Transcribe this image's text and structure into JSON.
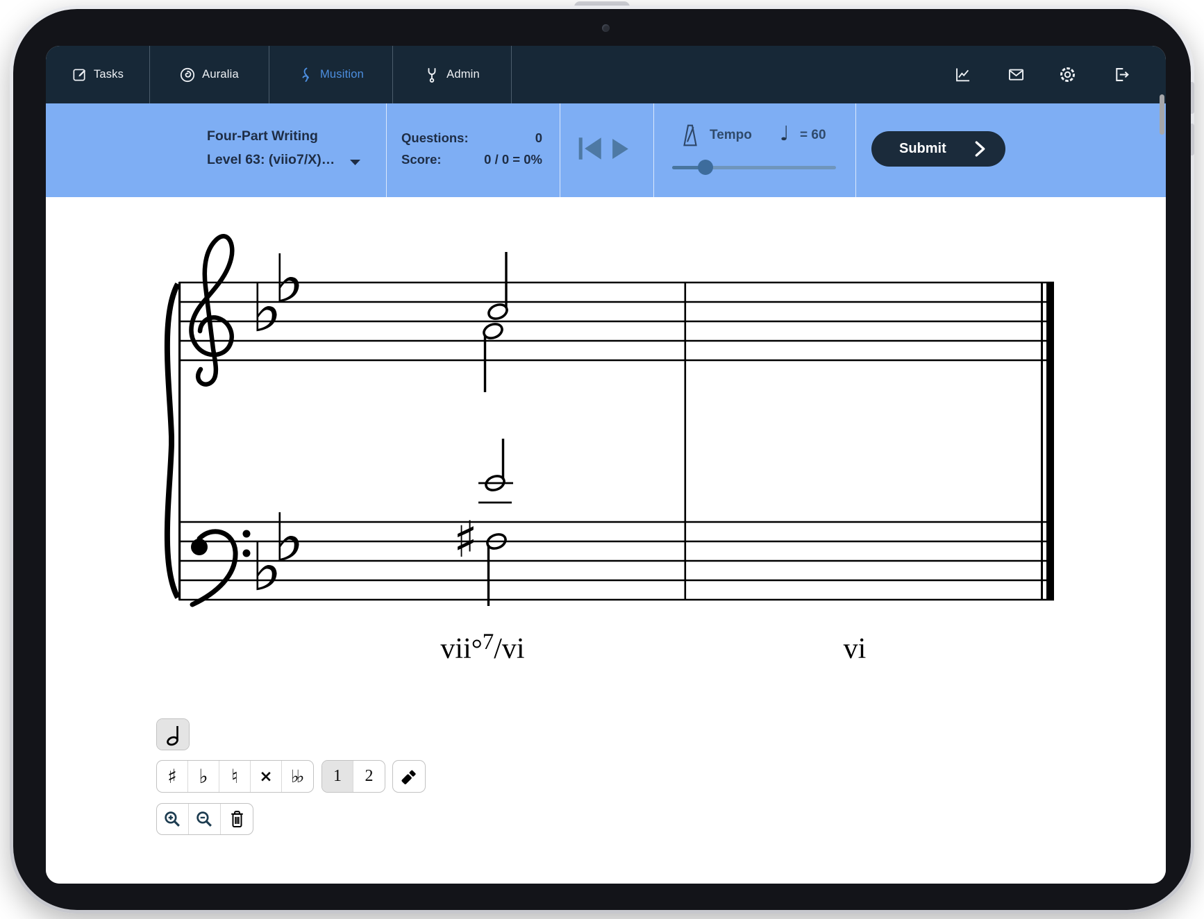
{
  "colors": {
    "navbar_bg": "#172837",
    "header_bg": "#7EAEF4",
    "active_tab_blue": "#4D8FE0",
    "playback_icon": "#4E79A4",
    "submit_bg": "#1B2B3B",
    "slider_track": "#6F95BC",
    "slider_track_active": "#48759E",
    "slider_thumb": "#3D6C9C",
    "header_text": "#1E2D45",
    "selected_button_bg": "#E4E4E4"
  },
  "nav": {
    "tabs": [
      {
        "label": "Tasks",
        "icon": "compose-icon",
        "active": false
      },
      {
        "label": "Auralia",
        "icon": "ear-spiral-icon",
        "active": false
      },
      {
        "label": "Musition",
        "icon": "music-swirl-icon",
        "active": true
      },
      {
        "label": "Admin",
        "icon": "wrench-icon",
        "active": false
      }
    ],
    "right_icons": [
      "stats-chart-icon",
      "messages-envelope-icon",
      "settings-gear-icon",
      "logout-icon"
    ]
  },
  "header": {
    "exercise_title": "Four-Part Writing",
    "level_label": "Level 63: (viio7/X)…",
    "questions_label": "Questions:",
    "questions_value": "0",
    "score_label": "Score:",
    "score_value": "0 / 0 = 0%",
    "tempo_label": "Tempo",
    "tempo_value": "= 60",
    "submit_label": "Submit"
  },
  "glyphs": {
    "flat": "♭",
    "sharp": "♯",
    "natural": "♮",
    "double_sharp": "×",
    "double_flat": "♭♭",
    "quarter_note": "♩"
  },
  "score": {
    "key_signature": "B-flat major (two flats)",
    "clefs": [
      "treble",
      "bass"
    ],
    "measures": 2,
    "chords": [
      {
        "roman_pre": "vii",
        "roman_dim": "°",
        "roman_seven": "7",
        "roman_post": "/vi",
        "notes": [
          {
            "voice": "soprano",
            "pitch": "C5",
            "duration": "half"
          },
          {
            "voice": "alto",
            "pitch": "A4",
            "duration": "half"
          },
          {
            "voice": "tenor",
            "pitch": "Eb4",
            "duration": "half"
          },
          {
            "voice": "bass",
            "pitch": "F#3",
            "duration": "half",
            "accidental": "sharp"
          }
        ]
      },
      {
        "roman": "vi",
        "notes": []
      }
    ]
  },
  "toolbar": {
    "duration_buttons": [
      {
        "name": "half-note",
        "selected": true
      }
    ],
    "accidental_buttons": [
      "sharp",
      "flat",
      "natural",
      "double-sharp",
      "double-flat"
    ],
    "voice_buttons": [
      {
        "label": "1",
        "selected": true
      },
      {
        "label": "2",
        "selected": false
      }
    ],
    "tools": [
      "eraser"
    ],
    "zoom_buttons": [
      "zoom-in",
      "zoom-out",
      "delete"
    ]
  }
}
